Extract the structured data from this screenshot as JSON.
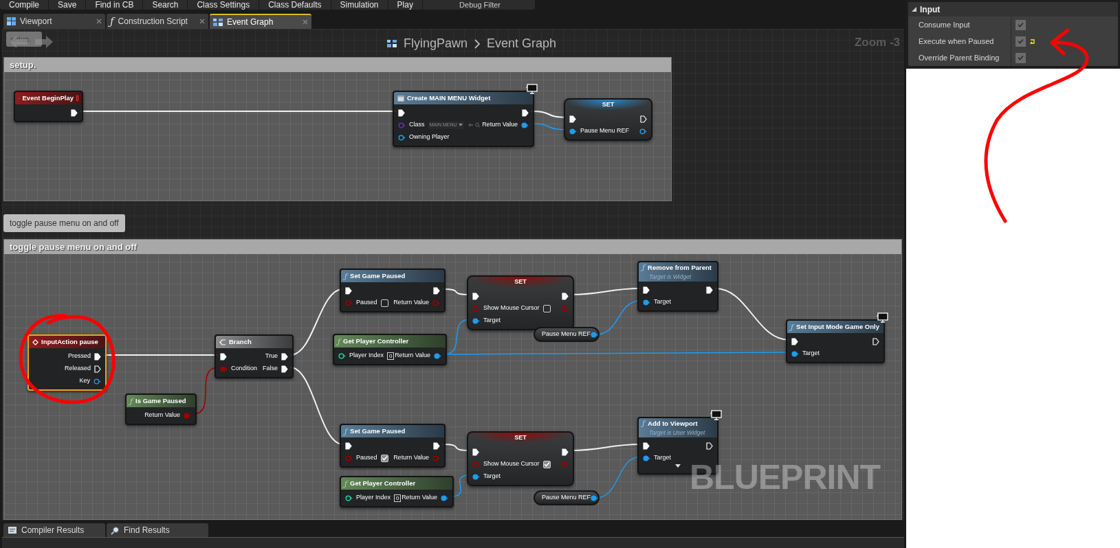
{
  "toolbar": {
    "buttons": [
      "Compile",
      "Save",
      "Find in CB",
      "Search",
      "Class Settings",
      "Class Defaults",
      "Simulation",
      "Play"
    ],
    "debug_filter": "Debug Filter"
  },
  "tabs": [
    {
      "label": "Viewport",
      "selected": false
    },
    {
      "glyph": "ƒ",
      "label": "Construction Script",
      "selected": false
    },
    {
      "label": "Event Graph",
      "selected": true
    }
  ],
  "graph": {
    "history_tooltip": "setup.",
    "breadcrumb": {
      "blueprint": "FlyingPawn",
      "graph": "Event Graph"
    },
    "zoom": "Zoom -3",
    "watermark": "BLUEPRINT",
    "comments": [
      {
        "title": "setup."
      },
      {
        "title": "toggle pause menu on and off",
        "bubble": "toggle pause menu on and off"
      }
    ],
    "nodes": [
      {
        "kind": "event",
        "title": "Event BeginPlay",
        "delegate_pin": true,
        "selected": false,
        "rows": [
          {
            "right": {
              "kind": "exec",
              "connected": true
            }
          }
        ]
      },
      {
        "kind": "create",
        "title": "Create MAIN MENU Widget",
        "monitor_badge": true,
        "selected": false,
        "rows": [
          {
            "left": {
              "kind": "exec",
              "connected": true
            },
            "right": {
              "kind": "exec",
              "connected": true
            }
          },
          {
            "left": {
              "kind": "data",
              "label": "Class",
              "color": "#6a2bc4",
              "connected": false,
              "value": "MAIN MENU"
            },
            "right": {
              "kind": "data",
              "label": "Return Value",
              "color": "#1e9cf0",
              "connected": true
            }
          },
          {
            "left": {
              "kind": "data",
              "label": "Owning Player",
              "color": "#1e9cf0",
              "connected": false
            }
          }
        ]
      },
      {
        "kind": "set",
        "title": "SET",
        "selected": false,
        "rows": [
          {
            "left": {
              "kind": "exec",
              "connected": true
            },
            "right": {
              "kind": "exec",
              "connected": false
            }
          },
          {
            "left": {
              "kind": "data",
              "label": "Pause Menu REF",
              "color": "#1e9cf0",
              "connected": true
            },
            "right": {
              "kind": "data",
              "color": "#1e9cf0",
              "connected": false
            }
          }
        ]
      },
      {
        "kind": "event",
        "title": "InputAction pause",
        "selected": true,
        "rows": [
          {
            "right": {
              "kind": "exec",
              "label": "Pressed",
              "connected": true
            }
          },
          {
            "right": {
              "kind": "exec",
              "label": "Released",
              "connected": false
            }
          },
          {
            "right": {
              "kind": "data",
              "label": "Key",
              "color": "#2a8ad8",
              "connected": false
            }
          }
        ]
      },
      {
        "kind": "pure",
        "glyph": "ƒ",
        "title": "Is Game Paused",
        "selected": false,
        "rows": [
          {
            "right": {
              "kind": "data",
              "label": "Return Value",
              "color": "#a00000",
              "connected": true
            }
          }
        ]
      },
      {
        "kind": "branch",
        "title": "Branch",
        "selected": false,
        "rows": [
          {
            "left": {
              "kind": "exec",
              "connected": true
            },
            "right": {
              "kind": "exec",
              "label": "True",
              "connected": true
            }
          },
          {
            "left": {
              "kind": "data",
              "label": "Condition",
              "color": "#a00000",
              "connected": true
            },
            "right": {
              "kind": "exec",
              "label": "False",
              "connected": true
            }
          }
        ]
      },
      {
        "kind": "call",
        "glyph": "ƒ",
        "title": "Set Game Paused",
        "selected": false,
        "rows": [
          {
            "left": {
              "kind": "exec",
              "connected": true
            },
            "right": {
              "kind": "exec",
              "connected": true
            }
          },
          {
            "left": {
              "kind": "data",
              "label": "Paused",
              "color": "#a00000",
              "connected": false,
              "checked": false
            },
            "right": {
              "kind": "data",
              "label": "Return Value",
              "color": "#a00000",
              "connected": false
            }
          }
        ]
      },
      {
        "kind": "pure",
        "glyph": "ƒ",
        "title": "Get Player Controller",
        "selected": false,
        "rows": [
          {
            "left": {
              "kind": "data",
              "label": "Player Index",
              "color": "#1fd1a0",
              "connected": false,
              "value": "0"
            },
            "right": {
              "kind": "data",
              "label": "Return Value",
              "color": "#1e9cf0",
              "connected": true
            }
          }
        ]
      },
      {
        "kind": "set",
        "title": "SET",
        "selected": false,
        "rows": [
          {
            "left": {
              "kind": "exec",
              "connected": true
            },
            "right": {
              "kind": "exec",
              "connected": true
            }
          },
          {
            "left": {
              "kind": "data",
              "label": "Show Mouse Cursor",
              "color": "#a00000",
              "connected": false,
              "checked": false
            },
            "right": {
              "kind": "data",
              "color": "#a00000",
              "connected": false
            }
          },
          {
            "left": {
              "kind": "data",
              "label": "Target",
              "color": "#1e9cf0",
              "connected": true
            }
          }
        ]
      },
      {
        "kind": "variable",
        "title": "Pause Menu REF",
        "selected": false,
        "rows": [
          {
            "right": {
              "kind": "data",
              "color": "#1e9cf0",
              "connected": true
            }
          }
        ]
      },
      {
        "kind": "call",
        "glyph": "ƒ",
        "title": "Remove from Parent",
        "subtitle": "Target is Widget",
        "selected": false,
        "rows": [
          {
            "left": {
              "kind": "exec",
              "connected": true
            },
            "right": {
              "kind": "exec",
              "connected": true
            }
          },
          {
            "left": {
              "kind": "data",
              "label": "Target",
              "color": "#1e9cf0",
              "connected": true
            }
          }
        ]
      },
      {
        "kind": "call",
        "glyph": "ƒ",
        "title": "Set Input Mode Game Only",
        "monitor_badge": true,
        "selected": false,
        "rows": [
          {
            "left": {
              "kind": "exec",
              "connected": true
            },
            "right": {
              "kind": "exec",
              "connected": false
            }
          },
          {
            "left": {
              "kind": "data",
              "label": "Target",
              "color": "#1e9cf0",
              "connected": true
            }
          }
        ]
      },
      {
        "kind": "call",
        "glyph": "ƒ",
        "title": "Set Game Paused",
        "selected": false,
        "rows": [
          {
            "left": {
              "kind": "exec",
              "connected": true
            },
            "right": {
              "kind": "exec",
              "connected": true
            }
          },
          {
            "left": {
              "kind": "data",
              "label": "Paused",
              "color": "#a00000",
              "connected": false,
              "checked": true
            },
            "right": {
              "kind": "data",
              "label": "Return Value",
              "color": "#a00000",
              "connected": false
            }
          }
        ]
      },
      {
        "kind": "pure",
        "glyph": "ƒ",
        "title": "Get Player Controller",
        "selected": false,
        "rows": [
          {
            "left": {
              "kind": "data",
              "label": "Player Index",
              "color": "#1fd1a0",
              "connected": false,
              "value": "0"
            },
            "right": {
              "kind": "data",
              "label": "Return Value",
              "color": "#1e9cf0",
              "connected": true
            }
          }
        ]
      },
      {
        "kind": "set",
        "title": "SET",
        "selected": false,
        "rows": [
          {
            "left": {
              "kind": "exec",
              "connected": true
            },
            "right": {
              "kind": "exec",
              "connected": true
            }
          },
          {
            "left": {
              "kind": "data",
              "label": "Show Mouse Cursor",
              "color": "#a00000",
              "connected": false,
              "checked": true
            },
            "right": {
              "kind": "data",
              "color": "#a00000",
              "connected": false
            }
          },
          {
            "left": {
              "kind": "data",
              "label": "Target",
              "color": "#1e9cf0",
              "connected": true
            }
          }
        ]
      },
      {
        "kind": "call",
        "glyph": "ƒ",
        "title": "Add to Viewport",
        "subtitle": "Target is User Widget",
        "monitor_badge": true,
        "advanced_pins": true,
        "selected": false,
        "rows": [
          {
            "left": {
              "kind": "exec",
              "connected": true
            },
            "right": {
              "kind": "exec",
              "connected": false
            }
          },
          {
            "left": {
              "kind": "data",
              "label": "Target",
              "color": "#1e9cf0",
              "connected": true
            }
          }
        ]
      },
      {
        "kind": "variable",
        "title": "Pause Menu REF",
        "selected": false,
        "rows": [
          {
            "right": {
              "kind": "data",
              "color": "#1e9cf0",
              "connected": true
            }
          }
        ]
      }
    ]
  },
  "bottom_tabs": [
    {
      "label": "Compiler Results",
      "selected": false
    },
    {
      "label": "Find Results",
      "selected": false
    }
  ],
  "details": {
    "section": "Input",
    "expanded": true,
    "rows": [
      {
        "label": "Consume Input",
        "checked": true,
        "modified": false
      },
      {
        "label": "Execute when Paused",
        "checked": true,
        "modified": true
      },
      {
        "label": "Override Parent Binding",
        "checked": true,
        "modified": false
      }
    ]
  }
}
